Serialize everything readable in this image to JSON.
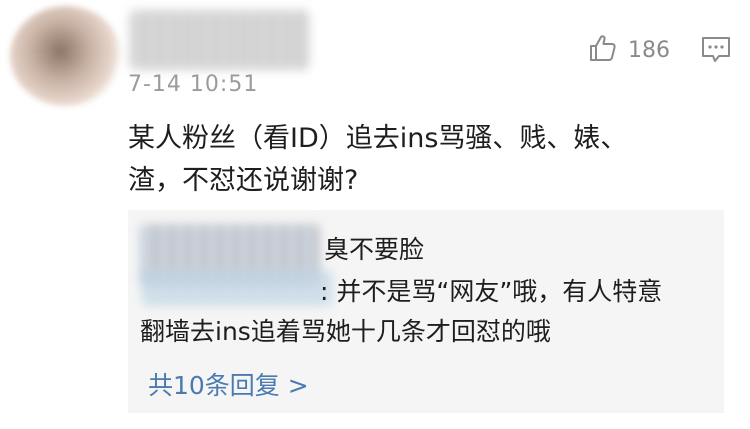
{
  "comment": {
    "timestamp": "7-14 10:51",
    "like_count": "186",
    "line1": "某人粉丝（看ID）追去ins骂骚、贱、婊、",
    "line2": "渣，不怼还说谢谢?",
    "icons": {
      "like": "thumbs-up-icon",
      "comment": "comment-icon"
    }
  },
  "reply_box": {
    "reply1_text": "臭不要脸",
    "reply2_line1": ": 并不是骂“网友”哦，有人特意",
    "reply2_line2": "翻墙去ins追着骂她十几条才回怼的哦",
    "more_replies": "共10条回复 >"
  },
  "colors": {
    "link": "#4a7bb0",
    "meta": "#9b9b9b",
    "reply_bg": "#f5f5f5"
  }
}
